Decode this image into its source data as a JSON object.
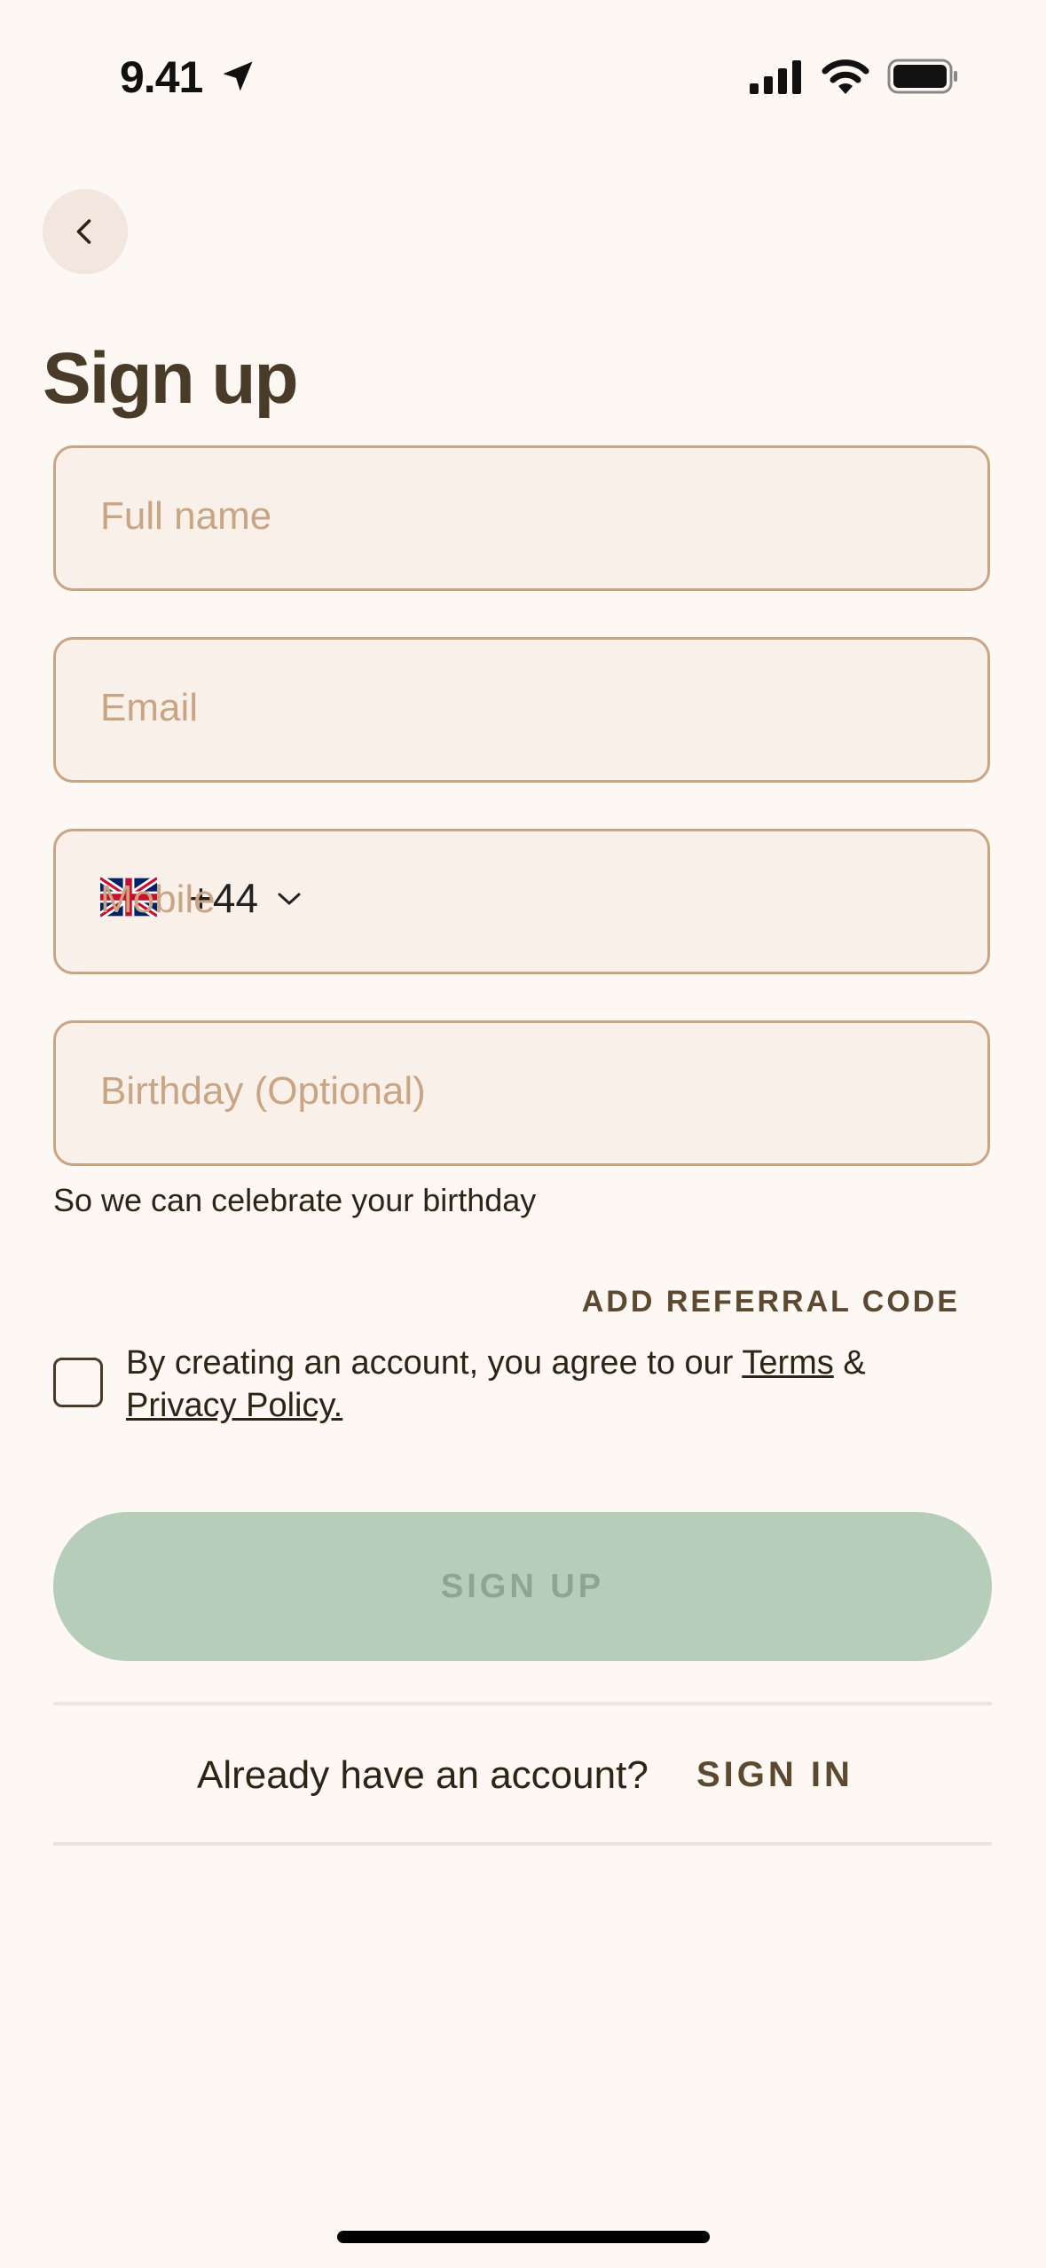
{
  "status_bar": {
    "time": "9.41"
  },
  "header": {
    "title": "Sign up"
  },
  "form": {
    "full_name": {
      "placeholder": "Full name"
    },
    "email": {
      "placeholder": "Email"
    },
    "phone": {
      "country_code": "+44",
      "placeholder": "Mobile"
    },
    "birthday": {
      "placeholder": "Birthday (Optional)",
      "helper": "So we can celebrate your birthday"
    }
  },
  "referral_label": "ADD REFERRAL CODE",
  "terms": {
    "prefix": "By creating an account, you agree to our ",
    "terms_link": "Terms",
    "amp": " & ",
    "privacy_link": "Privacy Policy."
  },
  "signup_button": "SIGN UP",
  "footer": {
    "question": "Already have an account?",
    "signin": "SIGN IN"
  },
  "colors": {
    "background": "#fdf8f4",
    "field_border": "#c9a583",
    "button_disabled": "#b6cdb9",
    "title": "#4a3a28"
  }
}
